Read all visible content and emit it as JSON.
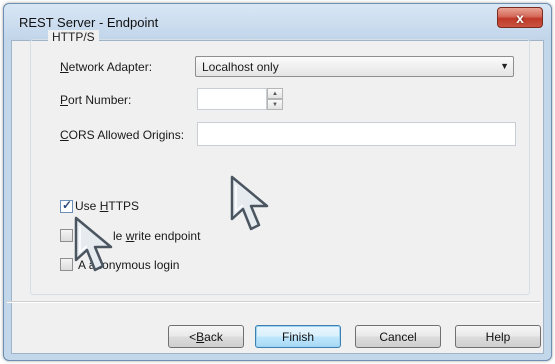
{
  "window": {
    "title": "REST Server - Endpoint",
    "close_glyph": "x"
  },
  "group": {
    "title": "HTTP/S"
  },
  "fields": {
    "network_adapter": {
      "label_underline": "N",
      "label_rest": "etwork Adapter:",
      "value": "Localhost only"
    },
    "port_number": {
      "label_underline": "P",
      "label_rest": "ort Number:",
      "value": ""
    },
    "cors": {
      "label_underline": "C",
      "label_rest": "ORS Allowed Origins:",
      "value": ""
    }
  },
  "checkboxes": {
    "use_https": {
      "label_pre": "Use ",
      "label_underline": "H",
      "label_rest": "TTPS",
      "checked": true
    },
    "write_endpoint": {
      "label_partial": "le ",
      "label_underline": "w",
      "label_rest": "rite endpoint",
      "checked": false
    },
    "anonymous_login": {
      "label_prefix_fragment": "A",
      "label_rest": "anonymous login",
      "checked": false
    }
  },
  "buttons": {
    "back": {
      "prefix": "< ",
      "underline": "B",
      "rest": "ack"
    },
    "finish": {
      "label": "Finish"
    },
    "cancel": {
      "label": "Cancel"
    },
    "help": {
      "label": "Help"
    }
  },
  "colors": {
    "accent": "#3c7fb1",
    "close": "#c0392b",
    "dialog_bg": "#f0f0f0"
  },
  "icons": [
    "close-icon",
    "dropdown-arrow-icon",
    "spin-up-icon",
    "spin-down-icon",
    "check-icon",
    "mouse-pointer-icon"
  ]
}
